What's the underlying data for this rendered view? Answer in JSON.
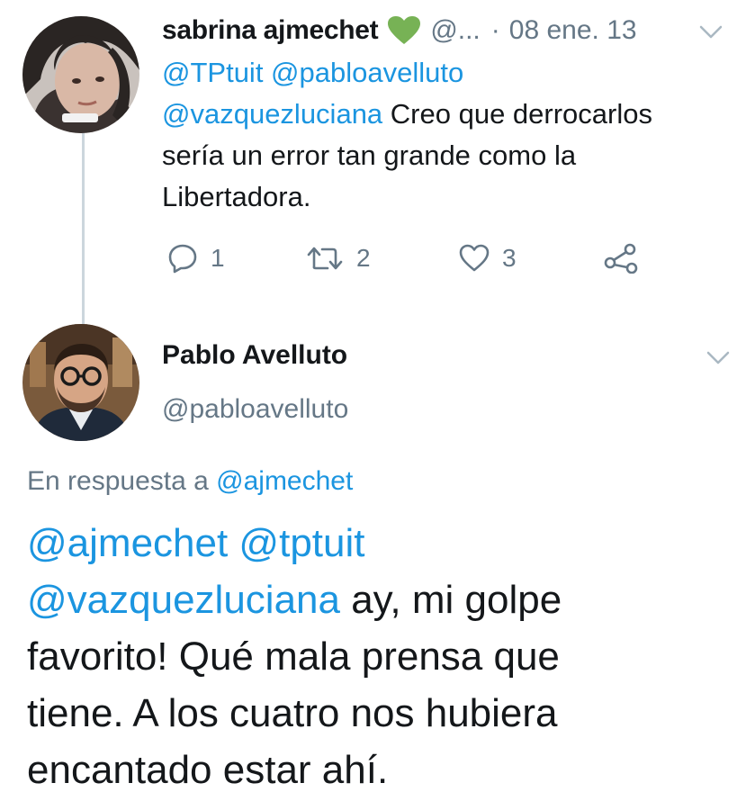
{
  "parent_tweet": {
    "author_name": "sabrina ajmechet",
    "name_emoji": "green-heart-emoji",
    "handle": "@...",
    "separator": "·",
    "date": "08 ene. 13",
    "mentions_line1": "@TPtuit @pabloavelluto",
    "mention3": "@vazquezluciana",
    "text_part1": " Creo que derrocarlos",
    "text_line2": "sería un error tan grande como la",
    "text_line3": "Libertadora.",
    "actions": {
      "reply_count": "1",
      "retweet_count": "2",
      "like_count": "3"
    },
    "icons": [
      "reply-icon",
      "retweet-icon",
      "like-icon",
      "share-icon",
      "chevron-down-icon"
    ]
  },
  "main_tweet": {
    "author_name": "Pablo Avelluto",
    "handle": "@pabloavelluto",
    "reply_prefix": "En respuesta a",
    "reply_to": "@ajmechet",
    "mentions_line1": "@ajmechet @tptuit",
    "mention3": "@vazquezluciana",
    "text_part1": " ay, mi golpe",
    "text_line2": "favorito! Qué mala prensa que",
    "text_line3": "tiene. A los cuatro nos hubiera",
    "text_line4": "encantado estar ahí."
  },
  "colors": {
    "link": "#1b95e0",
    "secondary_text": "#657786",
    "primary_text": "#14171a",
    "thread_line": "#ccd6dd",
    "heart": "#77b255"
  }
}
